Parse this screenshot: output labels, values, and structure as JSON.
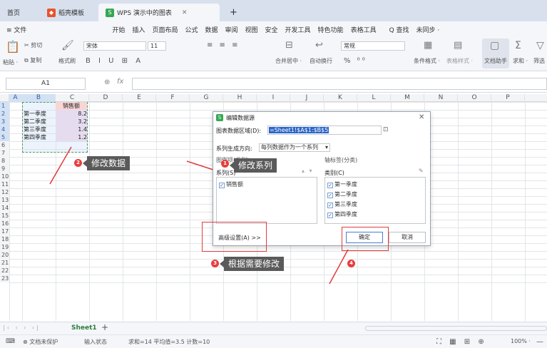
{
  "tabs": [
    {
      "label": "首页",
      "active": false
    },
    {
      "label": "稻壳模板",
      "active": false
    },
    {
      "label": "WPS 演示中的图表",
      "active": true
    }
  ],
  "menus": [
    "≡ 文件",
    "开始",
    "插入",
    "页面布局",
    "公式",
    "数据",
    "审阅",
    "视图",
    "安全",
    "开发工具",
    "特色功能",
    "表格工具",
    "Q 查找",
    "未同步 ·"
  ],
  "ribbon": {
    "cut": "剪切",
    "copy": "复制",
    "format_painter": "格式刷",
    "paste": "粘贴 ·",
    "font": "宋体",
    "size": "11",
    "number_format": "常规",
    "merge": "合并居中 ·",
    "wrap": "自动换行",
    "cond_format": "条件格式 ·",
    "table_style": "表格样式 ·",
    "doc_assist": "文档助手",
    "sum": "求和 ·",
    "filter": "筛选"
  },
  "formula_bar": {
    "name_box": "A1",
    "fx": "fx"
  },
  "columns": [
    "A",
    "B",
    "C",
    "D",
    "E",
    "F",
    "G",
    "H",
    "I",
    "J",
    "K",
    "L",
    "M",
    "N",
    "O",
    "P"
  ],
  "rows": [
    "1",
    "2",
    "3",
    "4",
    "5",
    "6",
    "7",
    "8",
    "9",
    "10",
    "11",
    "12",
    "13",
    "14",
    "15",
    "16",
    "17",
    "18",
    "19",
    "20",
    "21",
    "22",
    "23"
  ],
  "cells": {
    "b1": "销售额",
    "a2": "第一季度",
    "b2": "8.2",
    "a3": "第二季度",
    "b3": "3.2",
    "a4": "第三季度",
    "b4": "1.4",
    "a5": "第四季度",
    "b5": "1.2"
  },
  "dialog": {
    "title": "编辑数据源",
    "range_label": "图表数据区域(D):",
    "range_value": "=Sheet1!$A$1:$B$5",
    "direction_label": "系列生成方向:",
    "direction_value": "每列数据作为一个系列",
    "legend_label": "图例项(系列)",
    "series_label": "系列(S)",
    "series_items": [
      "销售额"
    ],
    "axis_label": "轴标签(分类)",
    "category_label": "类别(C)",
    "category_items": [
      "第一季度",
      "第二季度",
      "第三季度",
      "第四季度"
    ],
    "advanced_button": "高级设置(A) >>",
    "ok_button": "确定",
    "cancel_button": "取消"
  },
  "annotations": {
    "a1": {
      "num": "1",
      "text": "修改系列"
    },
    "a2": {
      "num": "2",
      "text": "修改数据"
    },
    "a3": {
      "num": "3",
      "text": "根据需要修改"
    },
    "a4": {
      "num": "4"
    }
  },
  "sheet": {
    "tab": "Sheet1",
    "add": "+"
  },
  "status": {
    "protect": "文档未保护",
    "input_state": "输入状态",
    "summary": "求和=14 平均值=3.5 计数=10",
    "zoom": "100% ·"
  },
  "colors": {
    "accent": "#35a852",
    "annotation": "#e83d3d",
    "selection": "#d3e1f4"
  }
}
